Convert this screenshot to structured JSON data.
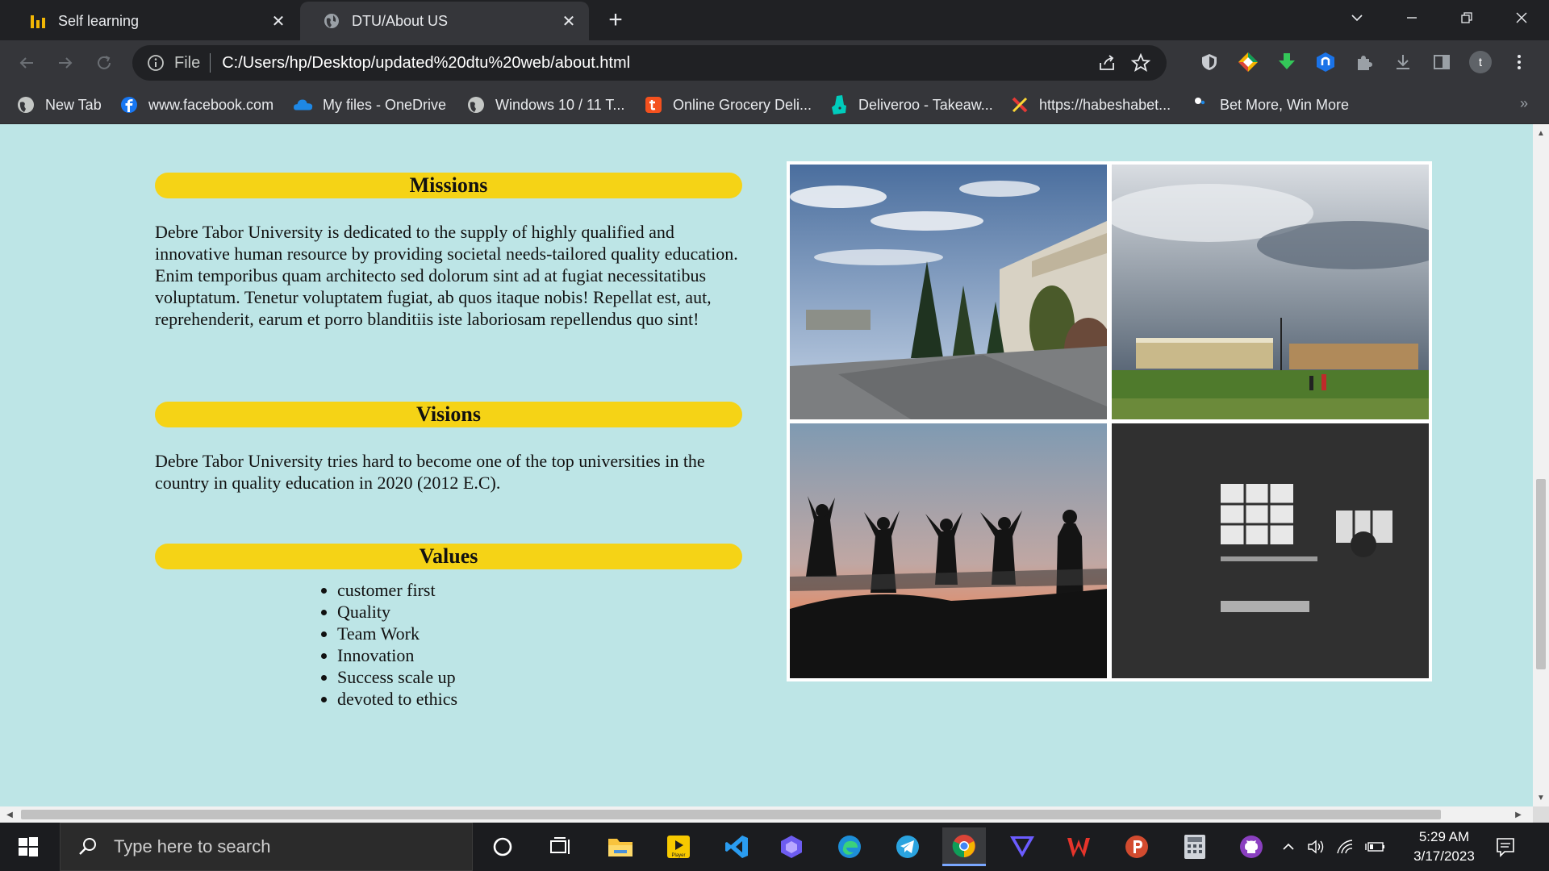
{
  "browser": {
    "tabs": [
      {
        "title": "Self learning",
        "icon": "bar-chart-icon",
        "active": false
      },
      {
        "title": "DTU/About US",
        "icon": "globe-icon",
        "active": true
      }
    ],
    "new_tab": "+",
    "address": {
      "scheme_label": "File",
      "url": "C:/Users/hp/Desktop/updated%20dtu%20web/about.html"
    },
    "bookmarks": [
      {
        "label": "New Tab",
        "icon": "globe-icon"
      },
      {
        "label": "www.facebook.com",
        "icon": "facebook-icon"
      },
      {
        "label": "My files - OneDrive",
        "icon": "onedrive-icon"
      },
      {
        "label": "Windows 10 / 11 T...",
        "icon": "globe-icon"
      },
      {
        "label": "Online Grocery Deli...",
        "icon": "grocery-icon"
      },
      {
        "label": "Deliveroo - Takeaw...",
        "icon": "deliveroo-icon"
      },
      {
        "label": "https://habeshabet...",
        "icon": "habeshabet-icon"
      },
      {
        "label": "Bet More, Win More",
        "icon": "bet-icon"
      }
    ],
    "profile_initial": "t",
    "accent": "#f5d316"
  },
  "page": {
    "missions": {
      "heading": "Missions",
      "text": "Debre Tabor University is dedicated to the supply of highly qualified and innovative human resource by providing societal needs-tailored quality education. Enim temporibus quam architecto sed dolorum sint ad at fugiat necessitatibus voluptatum. Tenetur voluptatem fugiat, ab quos itaque nobis! Repellat est, aut, reprehenderit, earum et porro blanditiis iste laboriosam repellendus quo sint!"
    },
    "visions": {
      "heading": "Visions",
      "text": "Debre Tabor University tries hard to become one of the top universities in the country in quality education in 2020 (2012 E.C)."
    },
    "values": {
      "heading": "Values",
      "items": [
        "customer first",
        "Quality",
        "Team Work",
        "Innovation",
        "Success scale up",
        "devoted to ethics"
      ]
    },
    "gallery": [
      {
        "alt": "campus-road"
      },
      {
        "alt": "campus-buildings-cloudy"
      },
      {
        "alt": "jumping-silhouettes-sunset"
      },
      {
        "alt": "dark-classroom"
      }
    ],
    "background": "#bde5e6"
  },
  "taskbar": {
    "search_placeholder": "Type here to search",
    "time": "5:29 AM",
    "date": "3/17/2023"
  }
}
